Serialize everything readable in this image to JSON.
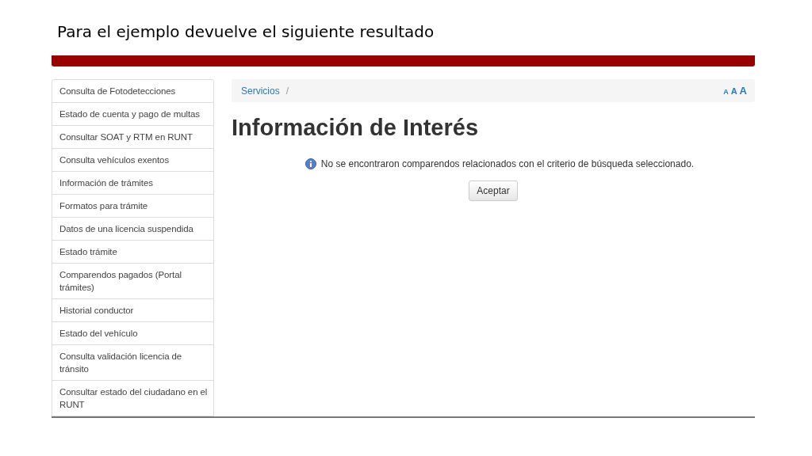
{
  "slide_title": "Para el ejemplo devuelve el siguiente resultado",
  "sidebar": {
    "items": [
      {
        "label": "Consulta de Fotodetecciones"
      },
      {
        "label": "Estado de cuenta y pago de multas"
      },
      {
        "label": "Consultar SOAT y RTM en RUNT"
      },
      {
        "label": "Consulta vehículos exentos"
      },
      {
        "label": "Información de trámites"
      },
      {
        "label": "Formatos para trámite"
      },
      {
        "label": "Datos de una licencia suspendida"
      },
      {
        "label": "Estado trámite"
      },
      {
        "label": "Comparendos pagados (Portal trámites)"
      },
      {
        "label": "Historial conductor"
      },
      {
        "label": "Estado del vehículo"
      },
      {
        "label": "Consulta validación licencia de tránsito"
      },
      {
        "label": "Consultar estado del ciudadano en el RUNT"
      }
    ]
  },
  "breadcrumb": {
    "items": [
      "Servicios"
    ],
    "separator": "/"
  },
  "font_size_controls": [
    "A",
    "A",
    "A"
  ],
  "heading": "Información de Interés",
  "message": "No se encontraron comparendos relacionados con el criterio de búsqueda seleccionado.",
  "button": "Aceptar"
}
